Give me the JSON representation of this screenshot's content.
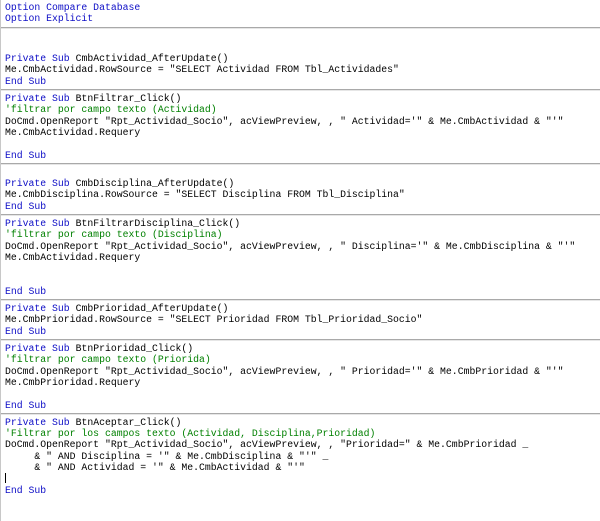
{
  "app": {
    "name": "VBA code editor",
    "language": "Visual Basic for Applications"
  },
  "colors": {
    "keyword": "#0d0dc6",
    "comment": "#008000",
    "code": "#000000",
    "separator": "#a9a9a9",
    "background": "#ffffff"
  },
  "editor": {
    "lines": [
      {
        "kind": "code",
        "segments": [
          [
            "keyword",
            "Option Compare Database"
          ]
        ]
      },
      {
        "kind": "code",
        "segments": [
          [
            "keyword",
            "Option Explicit"
          ]
        ]
      },
      {
        "kind": "sep"
      },
      {
        "kind": "blank"
      },
      {
        "kind": "blank"
      },
      {
        "kind": "code",
        "segments": [
          [
            "keyword",
            "Private Sub "
          ],
          [
            "code",
            "CmbActividad_AfterUpdate()"
          ]
        ]
      },
      {
        "kind": "code",
        "segments": [
          [
            "code",
            "Me.CmbActividad.RowSource = \"SELECT Actividad FROM Tbl_Actividades\""
          ]
        ]
      },
      {
        "kind": "code",
        "segments": [
          [
            "keyword",
            "End Sub"
          ]
        ]
      },
      {
        "kind": "sep"
      },
      {
        "kind": "code",
        "segments": [
          [
            "keyword",
            "Private Sub "
          ],
          [
            "code",
            "BtnFiltrar_Click()"
          ]
        ]
      },
      {
        "kind": "code",
        "segments": [
          [
            "comment",
            "'filtrar por campo texto (Actividad)"
          ]
        ]
      },
      {
        "kind": "code",
        "segments": [
          [
            "code",
            "DoCmd.OpenReport \"Rpt_Actividad_Socio\", acViewPreview, , \" Actividad='\" & Me.CmbActividad & \"'\""
          ]
        ]
      },
      {
        "kind": "code",
        "segments": [
          [
            "code",
            "Me.CmbActividad.Requery"
          ]
        ]
      },
      {
        "kind": "blank"
      },
      {
        "kind": "code",
        "segments": [
          [
            "keyword",
            "End Sub"
          ]
        ]
      },
      {
        "kind": "sep"
      },
      {
        "kind": "blank"
      },
      {
        "kind": "code",
        "segments": [
          [
            "keyword",
            "Private Sub "
          ],
          [
            "code",
            "CmbDisciplina_AfterUpdate()"
          ]
        ]
      },
      {
        "kind": "code",
        "segments": [
          [
            "code",
            "Me.CmbDisciplina.RowSource = \"SELECT Disciplina FROM Tbl_Disciplina\""
          ]
        ]
      },
      {
        "kind": "code",
        "segments": [
          [
            "keyword",
            "End Sub"
          ]
        ]
      },
      {
        "kind": "sep"
      },
      {
        "kind": "code",
        "segments": [
          [
            "keyword",
            "Private Sub "
          ],
          [
            "code",
            "BtnFiltrarDisciplina_Click()"
          ]
        ]
      },
      {
        "kind": "code",
        "segments": [
          [
            "comment",
            "'filtrar por campo texto (Disciplina)"
          ]
        ]
      },
      {
        "kind": "code",
        "segments": [
          [
            "code",
            "DoCmd.OpenReport \"Rpt_Actividad_Socio\", acViewPreview, , \" Disciplina='\" & Me.CmbDisciplina & \"'\""
          ]
        ]
      },
      {
        "kind": "code",
        "segments": [
          [
            "code",
            "Me.CmbActividad.Requery"
          ]
        ]
      },
      {
        "kind": "blank"
      },
      {
        "kind": "blank"
      },
      {
        "kind": "code",
        "segments": [
          [
            "keyword",
            "End Sub"
          ]
        ]
      },
      {
        "kind": "sep"
      },
      {
        "kind": "code",
        "segments": [
          [
            "keyword",
            "Private Sub "
          ],
          [
            "code",
            "CmbPrioridad_AfterUpdate()"
          ]
        ]
      },
      {
        "kind": "code",
        "segments": [
          [
            "code",
            "Me.CmbPrioridad.RowSource = \"SELECT Prioridad FROM Tbl_Prioridad_Socio\""
          ]
        ]
      },
      {
        "kind": "code",
        "segments": [
          [
            "keyword",
            "End Sub"
          ]
        ]
      },
      {
        "kind": "sep"
      },
      {
        "kind": "code",
        "segments": [
          [
            "keyword",
            "Private Sub "
          ],
          [
            "code",
            "BtnPrioridad_Click()"
          ]
        ]
      },
      {
        "kind": "code",
        "segments": [
          [
            "comment",
            "'filtrar por campo texto (Priorida)"
          ]
        ]
      },
      {
        "kind": "code",
        "segments": [
          [
            "code",
            "DoCmd.OpenReport \"Rpt_Actividad_Socio\", acViewPreview, , \" Prioridad='\" & Me.CmbPrioridad & \"'\""
          ]
        ]
      },
      {
        "kind": "code",
        "segments": [
          [
            "code",
            "Me.CmbPrioridad.Requery"
          ]
        ]
      },
      {
        "kind": "blank"
      },
      {
        "kind": "code",
        "segments": [
          [
            "keyword",
            "End Sub"
          ]
        ]
      },
      {
        "kind": "sep"
      },
      {
        "kind": "code",
        "segments": [
          [
            "keyword",
            "Private Sub "
          ],
          [
            "code",
            "BtnAceptar_Click()"
          ]
        ]
      },
      {
        "kind": "code",
        "segments": [
          [
            "comment",
            "'Filtrar por los campos texto (Actividad, Disciplina,Prioridad)"
          ]
        ]
      },
      {
        "kind": "code",
        "segments": [
          [
            "code",
            "DoCmd.OpenReport \"Rpt_Actividad_Socio\", acViewPreview, , \"Prioridad=\" & Me.CmbPrioridad _"
          ]
        ]
      },
      {
        "kind": "code",
        "segments": [
          [
            "code",
            "     & \" AND Disciplina = '\" & Me.CmbDisciplina & \"'\" _"
          ]
        ]
      },
      {
        "kind": "code",
        "segments": [
          [
            "code",
            "     & \" AND Actividad = '\" & Me.CmbActividad & \"'\""
          ]
        ]
      },
      {
        "kind": "cursor"
      },
      {
        "kind": "code",
        "segments": [
          [
            "keyword",
            "End Sub"
          ]
        ]
      }
    ]
  }
}
